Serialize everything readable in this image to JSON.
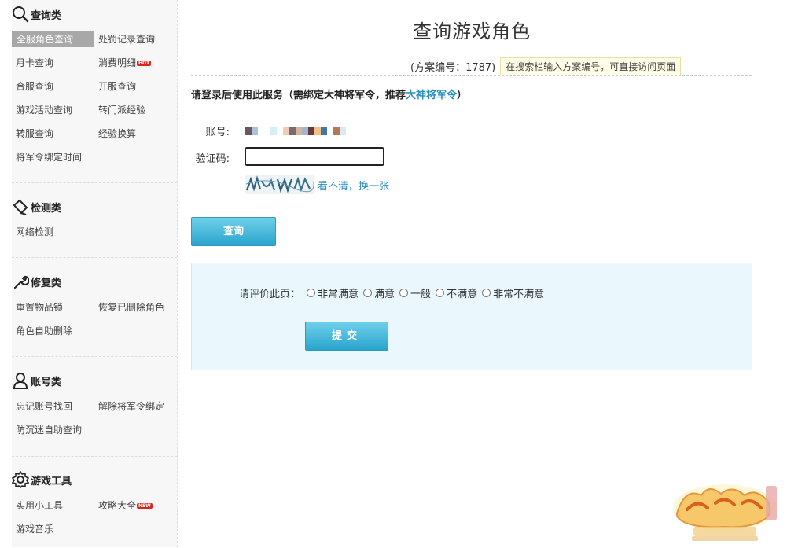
{
  "page": {
    "title": "查询游戏角色",
    "scheme_text": "(方案编号：1787)",
    "scheme_tip": "在搜索栏输入方案编号，可直接访问页面",
    "login_note_prefix": "请登录后使用此服务（需绑定大神将军令，推荐",
    "login_note_link": "大神将军令",
    "login_note_suffix": "）"
  },
  "sidebar": {
    "query": {
      "title": "查询类",
      "items": [
        "全服角色查询",
        "处罚记录查询",
        "月卡查询",
        "消费明细",
        "合服查询",
        "开服查询",
        "游戏活动查询",
        "转门派经验",
        "转服查询",
        "经验换算",
        "将军令绑定时间"
      ]
    },
    "detect": {
      "title": "检测类",
      "items": [
        "网络检测"
      ]
    },
    "repair": {
      "title": "修复类",
      "items": [
        "重置物品锁",
        "恢复已删除角色",
        "角色自助删除"
      ]
    },
    "account": {
      "title": "账号类",
      "items": [
        "忘记账号找回",
        "解除将军令绑定",
        "防沉迷自助查询"
      ]
    },
    "tools": {
      "title": "游戏工具",
      "items": [
        "实用小工具",
        "攻略大全",
        "游戏音乐"
      ]
    },
    "badges": {
      "hot": "HOT",
      "new": "NEW"
    }
  },
  "form": {
    "account_label": "账号:",
    "captcha_label": "验证码:",
    "captcha_value": "",
    "captcha_refresh": "看不清，换一张",
    "query_button": "查询"
  },
  "rating": {
    "label": "请评价此页：",
    "options": [
      "非常满意",
      "满意",
      "一般",
      "不满意",
      "非常不满意"
    ],
    "submit": "提交"
  },
  "colors": {
    "accent": "#2aa4cd",
    "link": "#2a8ebd",
    "active_item_bg": "#a8a8a8",
    "rating_bg": "#eaf8fd"
  },
  "account_mosaic_colors": [
    "#6b5560",
    "#a9c3de",
    "#ffffff",
    "#ffffff",
    "#d6eef7",
    "#ffffff",
    "#f2cbb0",
    "#7a6a72",
    "#d8b49a",
    "#9db8cf",
    "#6a3a3a",
    "#f0c08a",
    "#3e78a8",
    "#ffffff",
    "#b07a5a",
    "#dfe8f2"
  ]
}
